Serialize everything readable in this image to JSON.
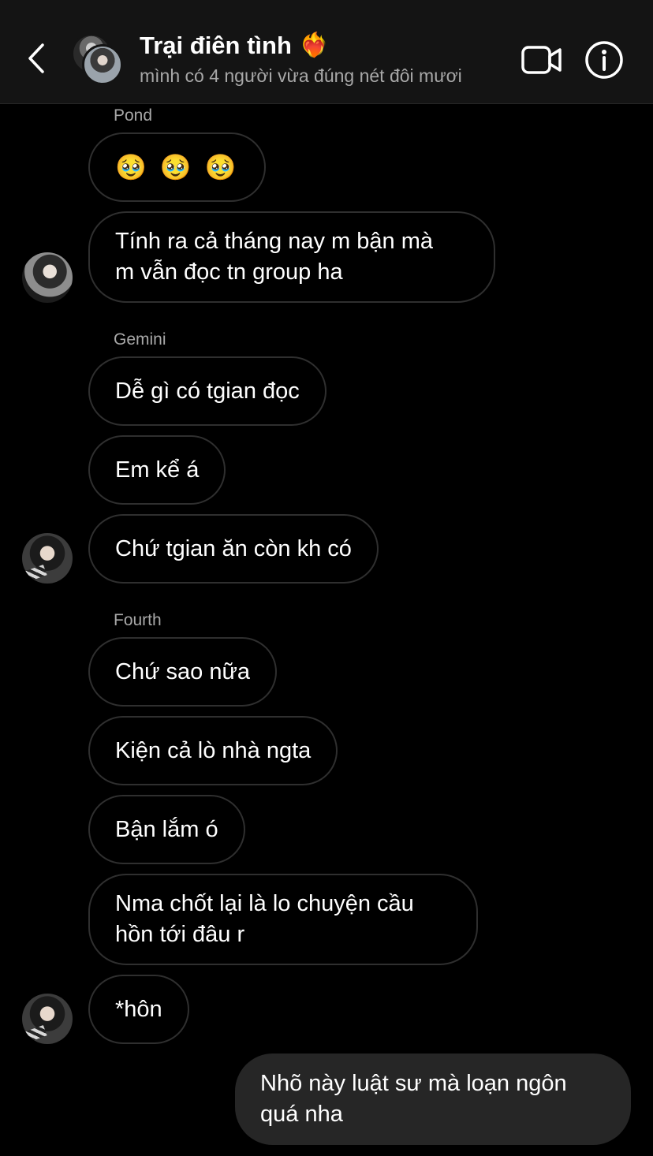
{
  "header": {
    "title": "Trại điên tình",
    "title_emoji": "❤️‍🔥",
    "subtitle": "mình có 4 người vừa đúng nét đôi mươi",
    "back_icon": "chevron-left-icon",
    "video_icon": "video-camera-icon",
    "info_icon": "info-icon"
  },
  "messages": {
    "pond": {
      "sender": "Pond",
      "m1": "🥹 🥹 🥹",
      "m2_line1": "Tính ra cả tháng nay m bận mà",
      "m2_line2": "m vẫn đọc tn group ha"
    },
    "gemini": {
      "sender": "Gemini",
      "m1": "Dễ gì có tgian đọc",
      "m2": "Em kể á",
      "m3": "Chứ tgian ăn còn kh có"
    },
    "fourth": {
      "sender": "Fourth",
      "m1": "Chứ sao nữa",
      "m2": "Kiện cả lò nhà ngta",
      "m3": "Bận lắm ó",
      "m4_line1": "Nma chốt lại là lo chuyện cầu",
      "m4_line2": "hồn tới đâu r",
      "m5": "*hôn"
    },
    "me": {
      "m1_line1": "Nhõ này luật sư mà loạn ngôn",
      "m1_line2": "quá nha"
    }
  },
  "colors": {
    "background": "#000000",
    "header_bg": "#141414",
    "bubble_border": "#2f2f2f",
    "my_bubble_bg": "#262626",
    "secondary_text": "#a8a8a8"
  }
}
